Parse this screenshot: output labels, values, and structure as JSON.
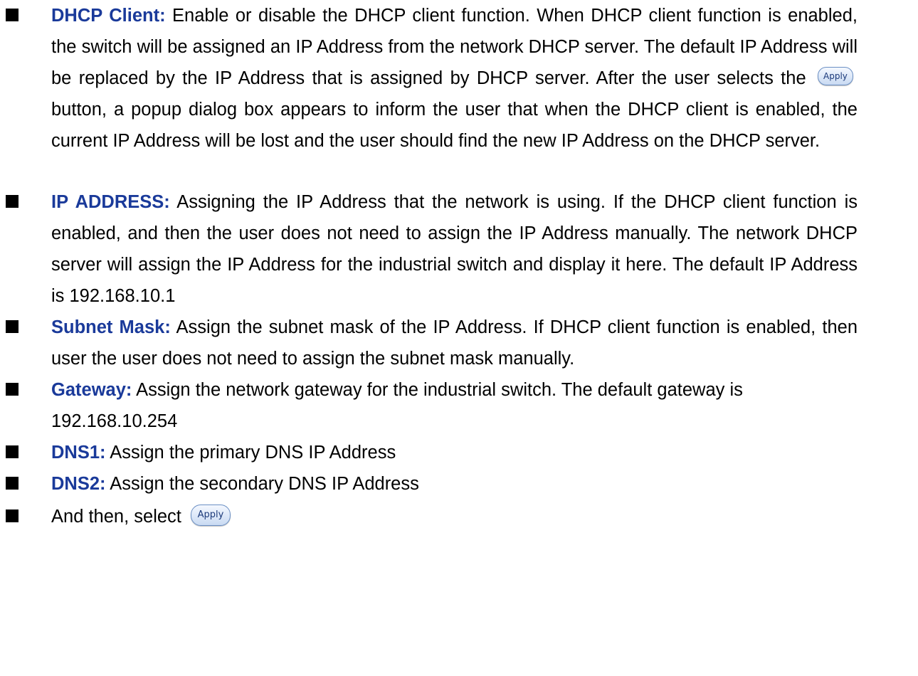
{
  "apply_button_label": "Apply",
  "items": [
    {
      "term": "DHCP Client:",
      "text_before_button": " Enable or disable the DHCP client function. When DHCP client function is enabled, the switch will be assigned an IP Address from the network DHCP server. The default IP Address will be replaced by the IP Address that is assigned by DHCP server. After the user selects the",
      "text_after_button": "button, a popup dialog box appears to inform the user that when the DHCP client is enabled, the current IP Address will be lost and the user should find the new IP Address on the DHCP server."
    },
    {
      "term": "IP ADDRESS:",
      "text": " Assigning the IP Address that the network is using. If the DHCP client function is enabled, and then the user does not need to assign the IP Address manually. The network DHCP server will assign the IP Address for the industrial switch and display it here. The default IP Address is 192.168.10.1"
    },
    {
      "term": "Subnet Mask:",
      "text": " Assign the subnet mask of the IP Address. If DHCP client function is enabled, then user the user does not need to assign the subnet mask manually."
    },
    {
      "term": "Gateway:",
      "text": " Assign the network gateway for the industrial switch. The default gateway is 192.168.10.254"
    },
    {
      "term": "DNS1:",
      "text": " Assign the primary DNS IP Address"
    },
    {
      "term": "DNS2:",
      "text": " Assign the secondary DNS IP Address"
    },
    {
      "text": "And then, select"
    }
  ],
  "colors": {
    "term": "#1a3a9a",
    "bullet": "#000000",
    "button_border": "#6a8fc4"
  }
}
